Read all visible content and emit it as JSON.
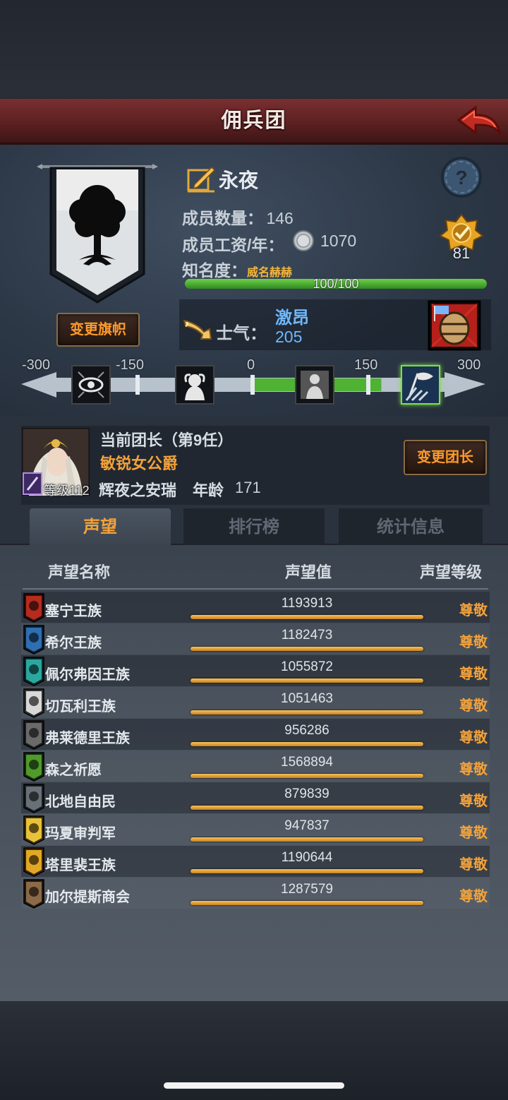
{
  "header": {
    "title": "佣兵团"
  },
  "guild": {
    "name": "永夜",
    "members_label": "成员数量：",
    "members_value": "146",
    "salary_label": "成员工资/年：",
    "salary_value": "1070",
    "fame_label": "知名度：",
    "fame_value": "威名赫赫",
    "fame_progress_text": "100/100",
    "fame_progress": 1.0,
    "level": "81",
    "change_banner_label": "变更旗帜"
  },
  "morale": {
    "label": "士气：",
    "state": "激昂",
    "value": "205",
    "scale_labels": [
      "-300",
      "-150",
      "0",
      "150",
      "300"
    ]
  },
  "leader": {
    "title": "当前团长（第9任）",
    "trait": "敏锐女公爵",
    "name": "辉夜之安瑞",
    "age_label": "年龄",
    "age": "171",
    "level": "等级112",
    "change_leader_label": "变更团长"
  },
  "tabs": {
    "reputation": "声望",
    "ranking": "排行榜",
    "stats": "统计信息"
  },
  "list": {
    "col_name": "声望名称",
    "col_value": "声望值",
    "col_level": "声望等级",
    "rows": [
      {
        "name": "塞宁王族",
        "value": "1193913",
        "level": "尊敬"
      },
      {
        "name": "希尔王族",
        "value": "1182473",
        "level": "尊敬"
      },
      {
        "name": "佩尔弗因王族",
        "value": "1055872",
        "level": "尊敬"
      },
      {
        "name": "切瓦利王族",
        "value": "1051463",
        "level": "尊敬"
      },
      {
        "name": "弗莱德里王族",
        "value": "956286",
        "level": "尊敬"
      },
      {
        "name": "森之祈愿",
        "value": "1568894",
        "level": "尊敬"
      },
      {
        "name": "北地自由民",
        "value": "879839",
        "level": "尊敬"
      },
      {
        "name": "玛夏审判军",
        "value": "947837",
        "level": "尊敬"
      },
      {
        "name": "塔里裴王族",
        "value": "1190644",
        "level": "尊敬"
      },
      {
        "name": "加尔提斯商会",
        "value": "1287579",
        "level": "尊敬"
      }
    ]
  },
  "colors": {
    "accent_orange": "#f3a23a",
    "morale_blue": "#6fb8ff",
    "fame_green": "#4fb233",
    "header_red": "#6a2425"
  }
}
